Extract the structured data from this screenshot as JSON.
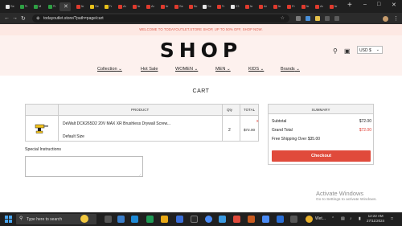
{
  "browser": {
    "tabs": [
      {
        "label": "Se",
        "color": "#e5e5e5"
      },
      {
        "label": "Pr",
        "color": "#2ea043"
      },
      {
        "label": "M",
        "color": "#2ea043"
      },
      {
        "label": "Pr",
        "color": "#2ea043"
      },
      {
        "label": "",
        "color": "#e5e5e5"
      },
      {
        "label": "Ar",
        "color": "#e03b2e"
      },
      {
        "label": "Se",
        "color": "#e8c21a"
      },
      {
        "label": "Fr",
        "color": "#e8c21a"
      },
      {
        "label": "Ar",
        "color": "#e03b2e"
      },
      {
        "label": "Ar",
        "color": "#e03b2e"
      },
      {
        "label": "Ar",
        "color": "#e03b2e"
      },
      {
        "label": "Ar",
        "color": "#e03b2e"
      },
      {
        "label": "Se",
        "color": "#e03b2e"
      },
      {
        "label": "Su",
        "color": "#e03b2e"
      },
      {
        "label": "Se",
        "color": "#e5e5e5"
      },
      {
        "label": "Fr",
        "color": "#e03b2e"
      },
      {
        "label": "23",
        "color": "#e5e5e5"
      },
      {
        "label": "Ar",
        "color": "#e03b2e"
      },
      {
        "label": "Ar",
        "color": "#e03b2e"
      },
      {
        "label": "Ar",
        "color": "#e03b2e"
      },
      {
        "label": "Fr",
        "color": "#e03b2e"
      },
      {
        "label": "Ar",
        "color": "#e03b2e"
      },
      {
        "label": "Ar",
        "color": "#e03b2e"
      },
      {
        "label": "Ar",
        "color": "#e03b2e"
      }
    ],
    "url": "todayoutlet.store/?path=page/cart"
  },
  "announcement": "WELCOME TO TODAYOUTLET.STORE SHOP, UP TO 50% OFF, SHOP NOW.",
  "header": {
    "logo": "SHOP",
    "currency": "USD $",
    "nav": [
      {
        "label": "Collection",
        "has_dropdown": true
      },
      {
        "label": "Hot Sale",
        "has_dropdown": false
      },
      {
        "label": "WOMEN",
        "has_dropdown": true
      },
      {
        "label": "MEN",
        "has_dropdown": true
      },
      {
        "label": "KIDS",
        "has_dropdown": true
      },
      {
        "label": "Brands",
        "has_dropdown": true
      }
    ]
  },
  "cart": {
    "title": "CART",
    "columns": {
      "product": "PRODUCT",
      "qty": "Qty",
      "total": "TOTAL"
    },
    "items": [
      {
        "name": "DeWalt DCK265D2 20V MAX XR Brushless Drywall Screw...",
        "variant": "Default Size",
        "qty": "2",
        "total": "$72.00"
      }
    ],
    "remove_label": "x",
    "instructions_label": "Special Instructions",
    "instructions_value": ""
  },
  "summary": {
    "title": "SUMMARY",
    "subtotal_label": "Subtotal",
    "subtotal_value": "$72.00",
    "grand_total_label": "Grand Total",
    "grand_total_value": "$72.00",
    "shipping_note": "Free Shipping Over $35.00",
    "checkout_label": "Checkout",
    "accent_color": "#e04a3b"
  },
  "watermark": {
    "line1": "Activate Windows",
    "line2": "Go to Settings to activate Windows."
  },
  "taskbar": {
    "search_placeholder": "Type here to search",
    "weather": "Wet...",
    "time": "12:22 AM",
    "date": "27/11/2024"
  }
}
